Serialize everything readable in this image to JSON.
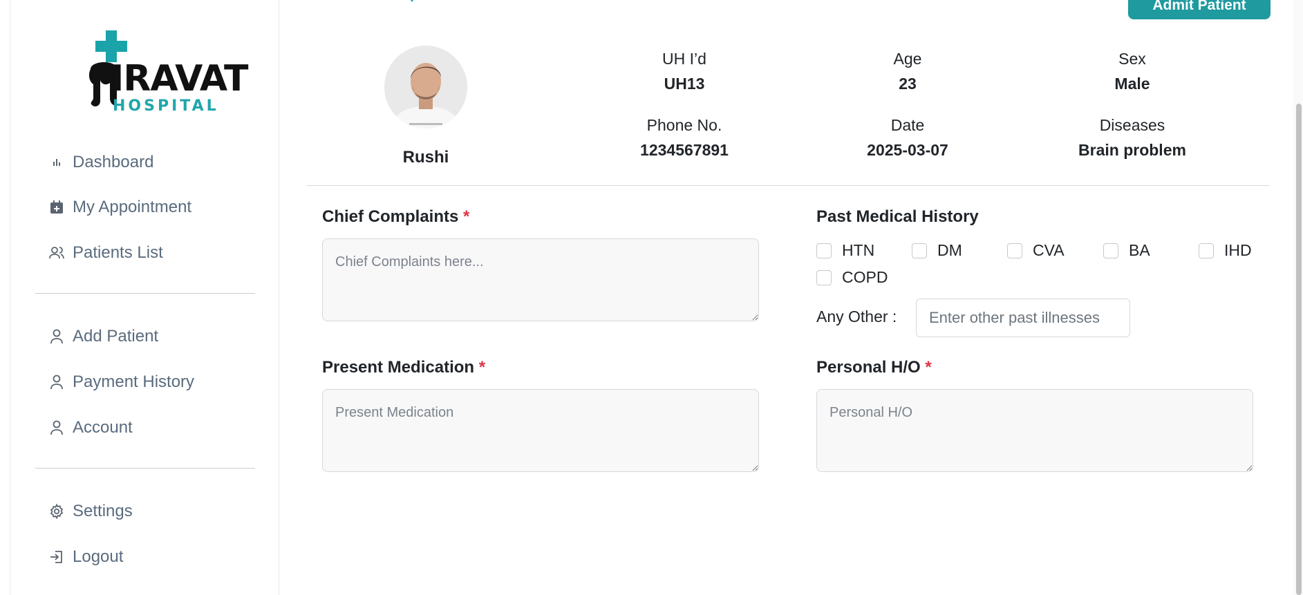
{
  "brand": {
    "name": "IRAVAT",
    "subtitle": "HOSPITAL",
    "accent_color": "#20a6ab",
    "cross_color": "#1aa3a8"
  },
  "sidebar": {
    "items": [
      {
        "label": "Dashboard",
        "icon": "bar-chart-icon"
      },
      {
        "label": "My Appointment",
        "icon": "calendar-plus-icon"
      },
      {
        "label": "Patients List",
        "icon": "users-icon"
      },
      {
        "label": "Add Patient",
        "icon": "user-icon"
      },
      {
        "label": "Payment History",
        "icon": "user-icon"
      },
      {
        "label": "Account",
        "icon": "user-icon"
      },
      {
        "label": "Settings",
        "icon": "gear-icon"
      },
      {
        "label": "Logout",
        "icon": "logout-icon"
      }
    ]
  },
  "header": {
    "admit_button": "Admit Patient",
    "button_color": "#1f9a9e"
  },
  "patient": {
    "name": "Rushi",
    "uhid_label": "UH I’d",
    "uhid": "UH13",
    "age_label": "Age",
    "age": "23",
    "sex_label": "Sex",
    "sex": "Male",
    "phone_label": "Phone No.",
    "phone": "1234567891",
    "date_label": "Date",
    "date": "2025-03-07",
    "diseases_label": "Diseases",
    "diseases": "Brain problem"
  },
  "form": {
    "chief_complaints": {
      "label": "Chief Complaints",
      "required": "*",
      "placeholder": "Chief Complaints here..."
    },
    "present_medication": {
      "label": "Present Medication",
      "required": "*",
      "placeholder": "Present Medication"
    },
    "past_medical_history": {
      "label": "Past Medical History",
      "options": [
        "HTN",
        "DM",
        "CVA",
        "BA",
        "IHD",
        "COPD"
      ],
      "any_other_label": "Any Other :",
      "any_other_placeholder": "Enter other past illnesses"
    },
    "personal_ho": {
      "label": "Personal H/O",
      "required": "*",
      "placeholder": "Personal H/O"
    }
  }
}
